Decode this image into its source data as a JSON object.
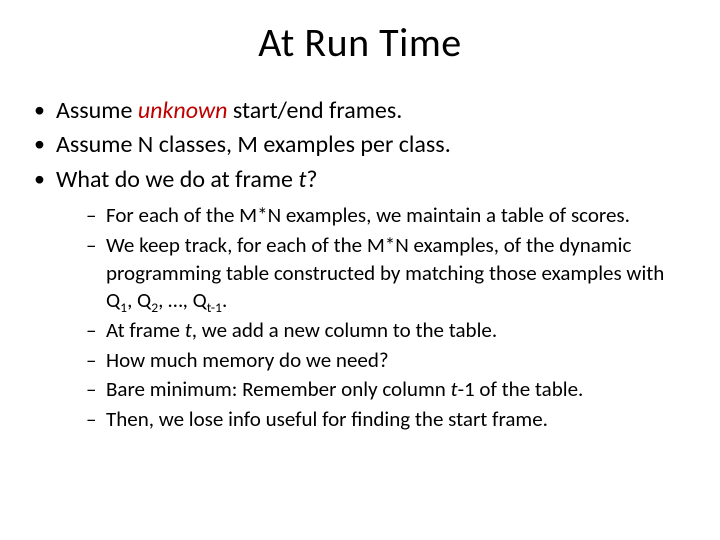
{
  "title": "At Run Time",
  "b1_pre": "Assume ",
  "b1_word": "unknown",
  "b1_post": " start/end frames.",
  "b2": "Assume N classes, M examples per class.",
  "b3_pre": "What do we do at frame ",
  "b3_t": "t",
  "b3_post": "?",
  "s1": "For each of the M*N examples, we maintain a table of scores.",
  "s2_pre": "We keep track, for each of the M*N examples, of the dynamic programming table constructed by matching those examples with Q",
  "s2_sub1": "1",
  "s2_mid1": ", Q",
  "s2_sub2": "2",
  "s2_mid2": ", …, Q",
  "s2_sub3": "t-1",
  "s2_post": ".",
  "s3_pre": "At frame ",
  "s3_t": "t",
  "s3_post": ", we add a new column to the table.",
  "s4": "How much memory do we need?",
  "s5_pre": "Bare minimum: Remember only column ",
  "s5_t": "t",
  "s5_post": "-1 of the table.",
  "s6": "Then, we lose info useful for finding the start frame."
}
